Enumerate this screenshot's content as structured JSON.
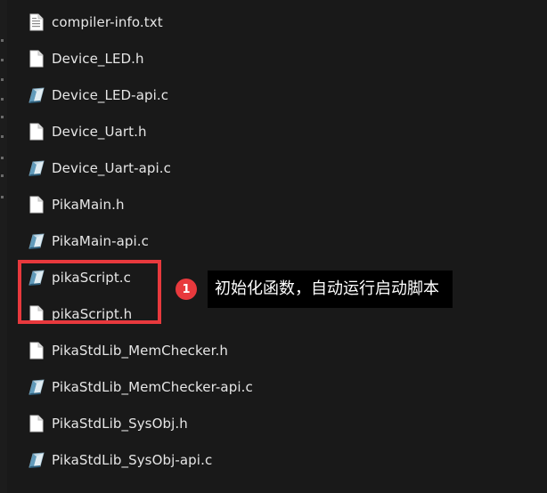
{
  "files": [
    {
      "name": "compiler-info.txt",
      "icon": "text-file-icon"
    },
    {
      "name": "Device_LED.h",
      "icon": "file-icon"
    },
    {
      "name": "Device_LED-api.c",
      "icon": "c-source-file-icon"
    },
    {
      "name": "Device_Uart.h",
      "icon": "file-icon"
    },
    {
      "name": "Device_Uart-api.c",
      "icon": "c-source-file-icon"
    },
    {
      "name": "PikaMain.h",
      "icon": "file-icon"
    },
    {
      "name": "PikaMain-api.c",
      "icon": "c-source-file-icon"
    },
    {
      "name": "pikaScript.c",
      "icon": "c-source-file-icon"
    },
    {
      "name": "pikaScript.h",
      "icon": "file-icon"
    },
    {
      "name": "PikaStdLib_MemChecker.h",
      "icon": "file-icon"
    },
    {
      "name": "PikaStdLib_MemChecker-api.c",
      "icon": "c-source-file-icon"
    },
    {
      "name": "PikaStdLib_SysObj.h",
      "icon": "file-icon"
    },
    {
      "name": "PikaStdLib_SysObj-api.c",
      "icon": "c-source-file-icon"
    }
  ],
  "annotation": {
    "badge": "1",
    "text": "初始化函数，自动运行启动脚本"
  },
  "colors": {
    "background": "#191919",
    "text": "#e6e6e6",
    "highlight": "#e8393d",
    "callout_background": "#000000"
  }
}
